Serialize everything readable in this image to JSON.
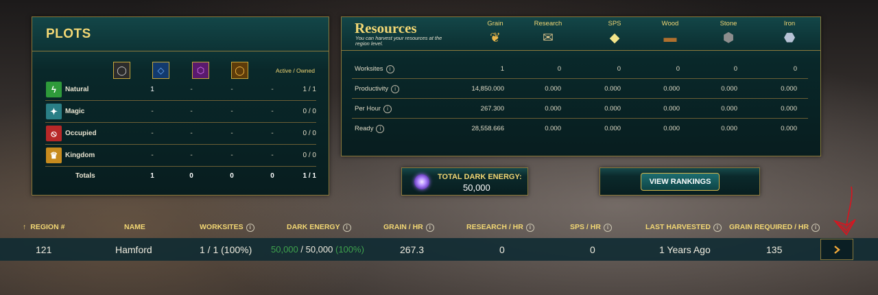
{
  "plots": {
    "title": "PLOTS",
    "active_owned_header": "Active / Owned",
    "rows": [
      {
        "label": "Natural",
        "icon": "natural-icon",
        "color": "#2e9a3a",
        "cells": [
          "1",
          "-",
          "-",
          "-"
        ],
        "active_owned": "1 / 1"
      },
      {
        "label": "Magic",
        "icon": "magic-icon",
        "color": "#2a7f86",
        "cells": [
          "-",
          "-",
          "-",
          "-"
        ],
        "active_owned": "0 / 0"
      },
      {
        "label": "Occupied",
        "icon": "occupied-icon",
        "color": "#b82828",
        "cells": [
          "-",
          "-",
          "-",
          "-"
        ],
        "active_owned": "0 / 0"
      },
      {
        "label": "Kingdom",
        "icon": "kingdom-icon",
        "color": "#c78b1e",
        "cells": [
          "-",
          "-",
          "-",
          "-"
        ],
        "active_owned": "0 / 0"
      }
    ],
    "totals": {
      "label": "Totals",
      "cells": [
        "1",
        "0",
        "0",
        "0"
      ],
      "active_owned": "1 / 1"
    },
    "tier_icons": [
      {
        "name": "common-plot-icon",
        "color": "#b8b8b8"
      },
      {
        "name": "rare-plot-icon",
        "color": "#3d7fe0"
      },
      {
        "name": "epic-plot-icon",
        "color": "#b53ad6"
      },
      {
        "name": "legendary-plot-icon",
        "color": "#e0a02a"
      }
    ]
  },
  "resources": {
    "title": "Resources",
    "subtitle": "You can harvest your resources at the region level.",
    "columns": [
      {
        "label": "Grain",
        "icon": "grain-icon"
      },
      {
        "label": "Research",
        "icon": "research-icon"
      },
      {
        "label": "SPS",
        "icon": "sps-icon"
      },
      {
        "label": "Wood",
        "icon": "wood-icon"
      },
      {
        "label": "Stone",
        "icon": "stone-icon"
      },
      {
        "label": "Iron",
        "icon": "iron-icon"
      }
    ],
    "rows": [
      {
        "label": "Worksites",
        "values": [
          "1",
          "0",
          "0",
          "0",
          "0",
          "0"
        ]
      },
      {
        "label": "Productivity",
        "values": [
          "14,850.000",
          "0.000",
          "0.000",
          "0.000",
          "0.000",
          "0.000"
        ]
      },
      {
        "label": "Per Hour",
        "values": [
          "267.300",
          "0.000",
          "0.000",
          "0.000",
          "0.000",
          "0.000"
        ]
      },
      {
        "label": "Ready",
        "values": [
          "28,558.666",
          "0.000",
          "0.000",
          "0.000",
          "0.000",
          "0.000"
        ]
      }
    ]
  },
  "dark_energy": {
    "label": "TOTAL DARK ENERGY:",
    "value": "50,000"
  },
  "rankings": {
    "button_label": "VIEW RANKINGS"
  },
  "region_table": {
    "headers": [
      "REGION #",
      "NAME",
      "WORKSITES",
      "DARK ENERGY",
      "GRAIN / HR",
      "RESEARCH / HR",
      "SPS / HR",
      "LAST HARVESTED",
      "GRAIN REQUIRED / HR"
    ],
    "sort_indicator": "↑",
    "row": {
      "region": "121",
      "name": "Hamford",
      "worksites": "1 / 1 (100%)",
      "dark_energy_current": "50,000",
      "dark_energy_sep": " / ",
      "dark_energy_max": "50,000",
      "dark_energy_pct": "(100%)",
      "grain_hr": "267.3",
      "research_hr": "0",
      "sps_hr": "0",
      "last_harvested": "1 Years Ago",
      "grain_required_hr": "135"
    },
    "go_icon": "chevron-right-icon"
  },
  "colors": {
    "gold": "#f2d774",
    "panel": "#0a3436",
    "border": "#8c7a3c",
    "green": "#3fa34d",
    "annotation": "#d9141f"
  }
}
